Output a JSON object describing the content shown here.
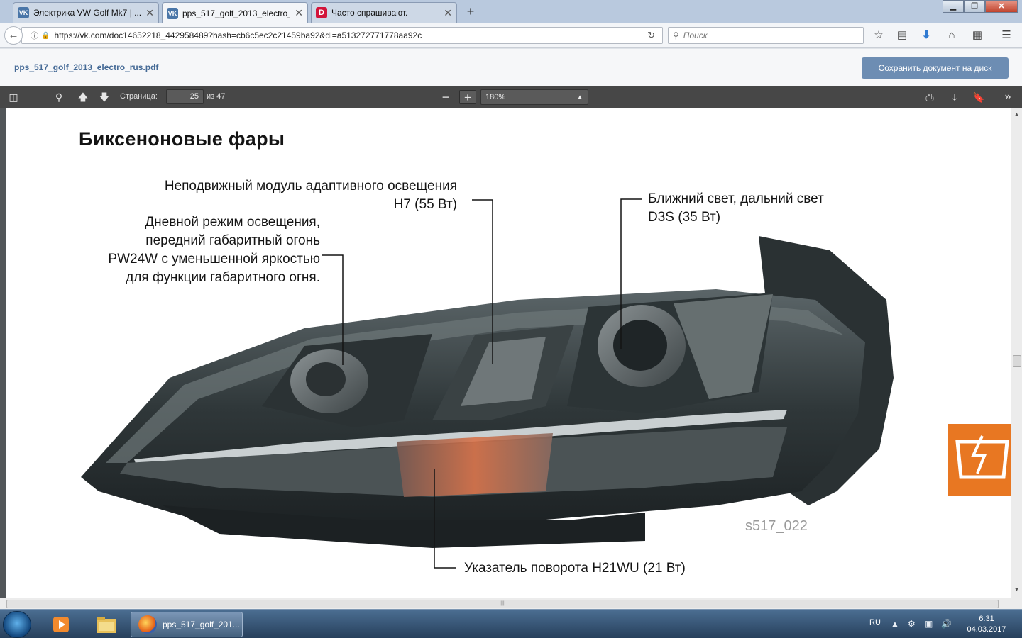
{
  "browser": {
    "tabs": [
      {
        "label": "Электрика VW Golf Mk7 | ...",
        "favicon": "vk-icon",
        "active": false
      },
      {
        "label": "pps_517_golf_2013_electro_...",
        "favicon": "vk-icon",
        "active": true
      },
      {
        "label": "Часто спрашивают.",
        "favicon": "d-icon",
        "active": false
      }
    ],
    "url": "https://vk.com/doc14652218_442958489?hash=cb6c5ec2c21459ba92&dl=a513272771778aa92c",
    "search_placeholder": "Поиск",
    "accent": "#2f7ad1"
  },
  "doc": {
    "filename": "pps_517_golf_2013_electro_rus.pdf",
    "save_label": "Сохранить документ на диск"
  },
  "pdf_toolbar": {
    "page_label": "Страница:",
    "page_current": "25",
    "page_total": "из 47",
    "zoom": "180%"
  },
  "page": {
    "title": "Биксеноновые фары",
    "callout_fixed_module": [
      "Неподвижный модуль адаптивного освещения",
      "H7 (55 Вт)"
    ],
    "callout_daytime": [
      "Дневной режим освещения,",
      "передний габаритный огонь",
      "PW24W с уменьшенной яркостью",
      "для функции габаритного огня."
    ],
    "callout_beam": [
      "Ближний свет, дальний свет",
      "D3S (35 Вт)"
    ],
    "callout_turn": "Указатель поворота H21WU (21 Вт)",
    "figure_id": "s517_022",
    "badge_color": "#e87722"
  },
  "taskbar": {
    "active_item": "pps_517_golf_201...",
    "language": "RU",
    "time": "6:31",
    "date": "04.03.2017"
  }
}
